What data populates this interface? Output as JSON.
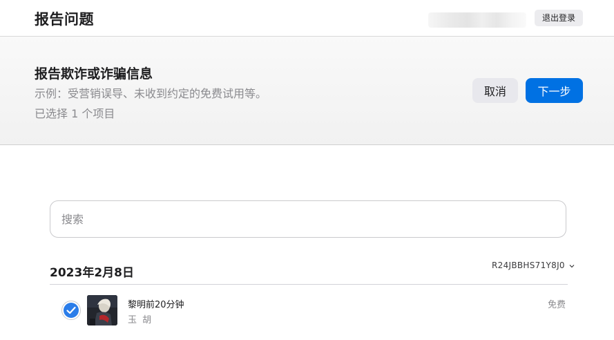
{
  "header": {
    "title": "报告问题",
    "logout_label": "退出登录"
  },
  "banner": {
    "heading": "报告欺诈或诈骗信息",
    "example": "示例：受营销误导、未收到约定的免费试用等。",
    "selected_count": "已选择 1 个项目",
    "cancel_label": "取消",
    "next_label": "下一步"
  },
  "search": {
    "placeholder": "搜索"
  },
  "purchases": [
    {
      "date": "2023年2月8日",
      "order_id": "R24JBBHS71Y8J0",
      "items": [
        {
          "title": "黎明前20分钟",
          "artist": "玉 胡",
          "price": "免费",
          "selected": true
        }
      ]
    }
  ],
  "icons": {
    "order_toggle": "chevron-down-icon",
    "selection": "checkmark-icon"
  },
  "colors": {
    "accent": "#0071e3",
    "checkbox": "#2b7de9"
  }
}
